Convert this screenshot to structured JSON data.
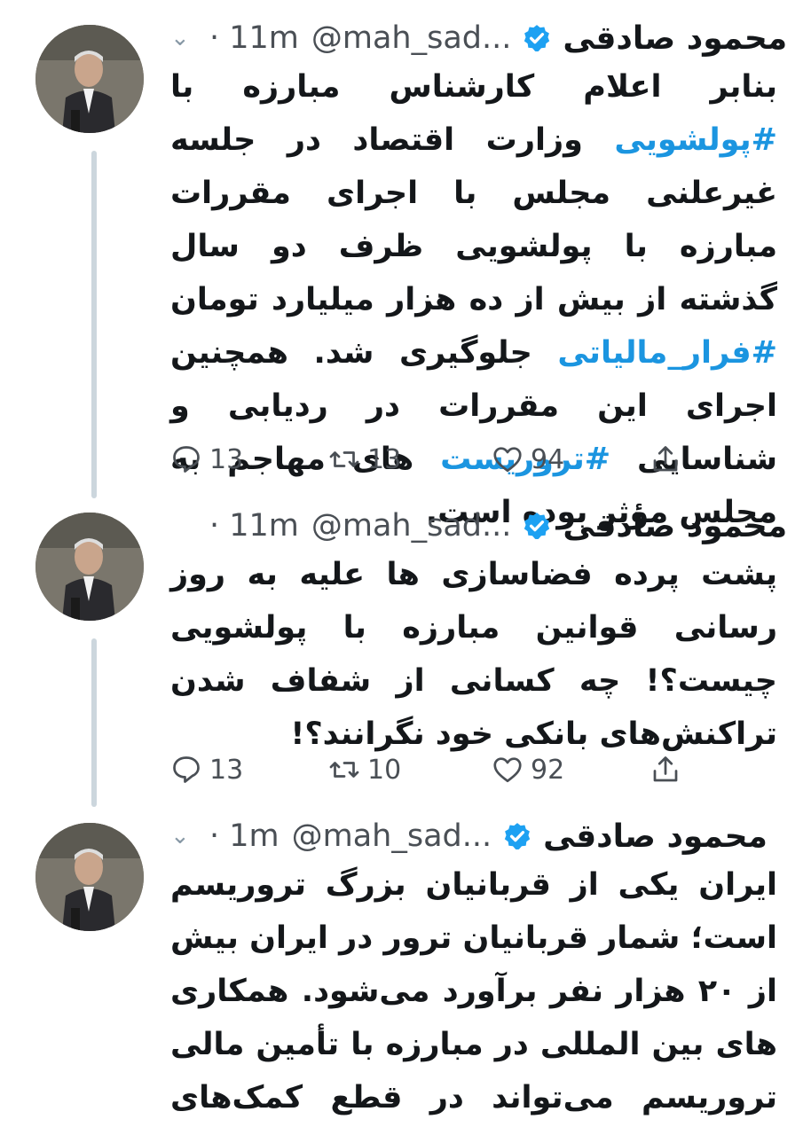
{
  "tweets": [
    {
      "author_name": "محمود صادقی",
      "handle": "@mah_sad...",
      "time": "· 11m",
      "text_parts": [
        "بنابر اعلام کارشناس مبارزه با ",
        "#پولشویی",
        " وزارت اقتصاد در جلسه غیرعلنی مجلس با اجرای مقررات مبارزه با پولشویی ظرف دو سال گذشته از بیش از ده هزار میلیارد تومان ",
        "#فرار_مالیاتی",
        " جلوگیری شد. همچنین اجرای این مقررات در ردیابی و شناسایی ",
        "#تروریست",
        " های مهاجم به مجلس مؤثر بوده است."
      ],
      "replies": "13",
      "retweets": "13",
      "likes": "94"
    },
    {
      "author_name": "محمود صادقی",
      "handle": "@mah_sad...",
      "time": "· 11m",
      "text": "پشت پرده فضاسازی ها علیه به روز رسانی قوانین مبارزه با پولشویی چیست؟! چه کسانی از شفاف شدن تراکنش‌های بانکی خود نگرانند؟!",
      "replies": "13",
      "retweets": "10",
      "likes": "92"
    },
    {
      "author_name": "محمود صادقی",
      "handle": "@mah_sad...",
      "time": "· 1m",
      "text": "ایران یکی از قربانیان بزرگ تروریسم است؛ شمار قربانیان ترور در ایران بیش از ۲۰ هزار نفر برآورد می‌شود. همکاری های بین المللی در مبارزه با تأمین مالی تروریسم می‌تواند در قطع کمک‌های مالی به تروریست ها مؤثر باشد."
    }
  ],
  "icons": {
    "reply": "reply-icon",
    "retweet": "retweet-icon",
    "like": "heart-icon",
    "share": "share-icon",
    "verified": "verified-badge-icon",
    "menu": "chevron-down-icon"
  },
  "colors": {
    "hashtag": "#1b95e0",
    "verified": "#1da1f2",
    "thread_line": "#ccd6dd",
    "secondary_text": "#4a4f55"
  }
}
